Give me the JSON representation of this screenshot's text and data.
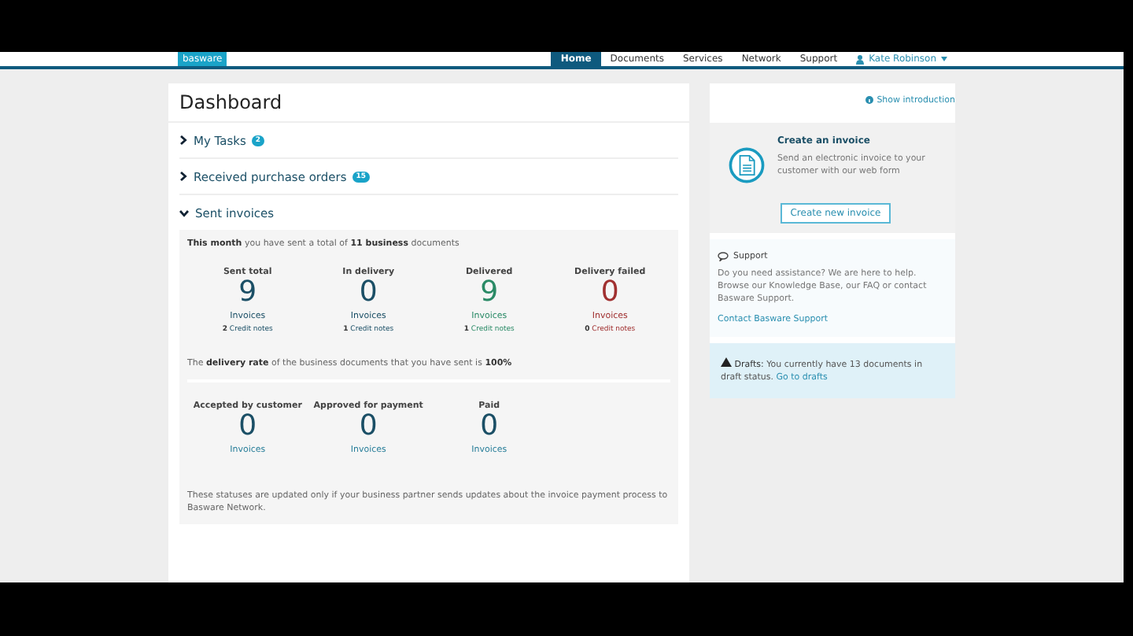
{
  "nav": {
    "logo": "basware",
    "items": [
      {
        "label": "Home",
        "selected": true
      },
      {
        "label": "Documents",
        "selected": false
      },
      {
        "label": "Services",
        "selected": false
      },
      {
        "label": "Network",
        "selected": false
      },
      {
        "label": "Support",
        "selected": false
      }
    ],
    "user": "Kate Robinson"
  },
  "dashboard": {
    "title": "Dashboard",
    "show_intro": "Show introduction",
    "sections": [
      {
        "title": "My Tasks",
        "badge": "2",
        "expanded": false
      },
      {
        "title": "Received purchase orders",
        "badge": "15",
        "expanded": false
      },
      {
        "title": "Sent invoices",
        "expanded": true
      }
    ],
    "summary": "**This month** you have sent a total of **11 business** documents",
    "stats": [
      {
        "label": "Sent total",
        "value": "9",
        "unit": "Invoices",
        "credit_count": "2",
        "credit_label": "Credit notes",
        "color": "#1b4f66"
      },
      {
        "label": "In delivery",
        "value": "0",
        "unit": "Invoices",
        "credit_count": "1",
        "credit_label": "Credit notes",
        "color": "#1b4f66"
      },
      {
        "label": "Delivered",
        "value": "9",
        "unit": "Invoices",
        "credit_count": "1",
        "credit_label": "Credit notes",
        "color": "#2a8a66"
      },
      {
        "label": "Delivery failed",
        "value": "0",
        "unit": "Invoices",
        "credit_count": "0",
        "credit_label": "Credit notes",
        "color": "#a03030"
      }
    ],
    "delivery_rate": "The **delivery rate** of the business documents that you have sent is **100%**",
    "payment_stats": [
      {
        "label": "Accepted by customer",
        "value": "0",
        "unit": "Invoices"
      },
      {
        "label": "Approved for payment",
        "value": "0",
        "unit": "Invoices"
      },
      {
        "label": "Paid",
        "value": "0",
        "unit": "Invoices"
      }
    ],
    "note": "These statuses are updated only if your business partner sends updates about the invoice payment process to Basware Network."
  },
  "sidebar": {
    "create": {
      "title": "Create an invoice",
      "text": "Send an electronic invoice to your customer with our web form",
      "button": "Create new invoice"
    },
    "support": {
      "title": "Support",
      "text": "Do you need assistance? We are here to help. Browse our Knowledge Base, our FAQ or contact Basware Support.",
      "link": "Contact Basware Support"
    },
    "drafts": {
      "label": "Drafts:",
      "text": "You currently have 13 documents in draft status.",
      "link": "Go to drafts"
    }
  }
}
